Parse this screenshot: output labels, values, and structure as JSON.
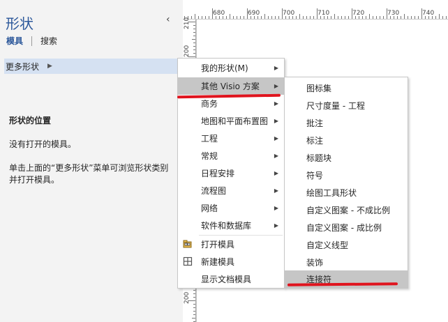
{
  "pane": {
    "title": "形状",
    "collapse_glyph": "‹",
    "tabs": {
      "stencils": "模具",
      "search": "搜索"
    },
    "more_shapes": "更多形状",
    "more_arrow": "▶",
    "heading": "形状的位置",
    "no_stencils": "没有打开的模具。",
    "hint": "单击上面的“更多形状”菜单可浏览形状类别并打开模具。"
  },
  "ruler": {
    "top_ticks": [
      "680",
      "690",
      "700",
      "710",
      "720",
      "730",
      "740"
    ],
    "left_ticks": [
      "210",
      "200",
      "130",
      "200"
    ]
  },
  "menu1": {
    "items": [
      "我的形状(M)",
      "其他 Visio 方案",
      "商务",
      "地图和平面布置图",
      "工程",
      "常规",
      "日程安排",
      "流程图",
      "网络",
      "软件和数据库",
      "打开模具",
      "新建模具",
      "显示文档模具"
    ],
    "submenu_glyph": "▶"
  },
  "menu2": {
    "items": [
      "图标集",
      "尺寸度量 - 工程",
      "批注",
      "标注",
      "标题块",
      "符号",
      "绘图工具形状",
      "自定义图案 - 不成比例",
      "自定义图案 - 成比例",
      "自定义线型",
      "装饰",
      "连接符"
    ]
  },
  "colors": {
    "accent": "#2b579a",
    "highlight": "#c6c6c6",
    "selection": "#d5e1f2",
    "annotation_red": "#e0141e"
  }
}
